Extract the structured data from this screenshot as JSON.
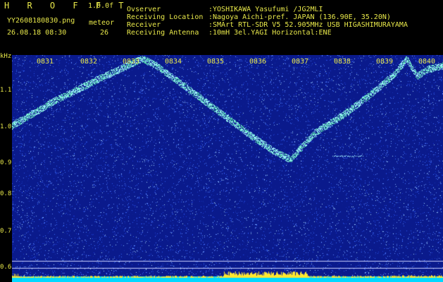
{
  "header": {
    "title_letters": "H R O F F T",
    "version": "1.0.0f",
    "filename": "YY2608180830.png",
    "meteor_label": "meteor",
    "datetime": "26.08.18 08:30",
    "meteor_count": "26",
    "info_labels": [
      "Ovserver",
      "Receiving Location",
      "Receiver",
      "Receiving Antenna"
    ],
    "info_values": [
      ":YOSHIKAWA Yasufumi /JG2MLI",
      ":Nagoya Aichi-pref. JAPAN (136.90E, 35.20N)",
      ":SMArt RTL-SDR V5 52.905MHz USB HIGASHIMURAYAMA",
      ":10mH 3el.YAGI Horizontal:ENE"
    ]
  },
  "chart_data": {
    "type": "heatmap",
    "y_unit": "kHz",
    "y_ticks": [
      "1.1",
      "1.0",
      "0.9",
      "0.8",
      "0.7",
      "0.6"
    ],
    "x_ticks": [
      "0831",
      "0832",
      "0833",
      "0834",
      "0835",
      "0836",
      "0837",
      "0838",
      "0839",
      "0840"
    ],
    "ylim": [
      0.6,
      1.15
    ],
    "colors": {
      "background": "#0a1a8c",
      "noise": "#3a6cff",
      "signal": "#9ff0ff",
      "text": "#e8e84a",
      "bottom_bar": "#00d8ff"
    }
  }
}
